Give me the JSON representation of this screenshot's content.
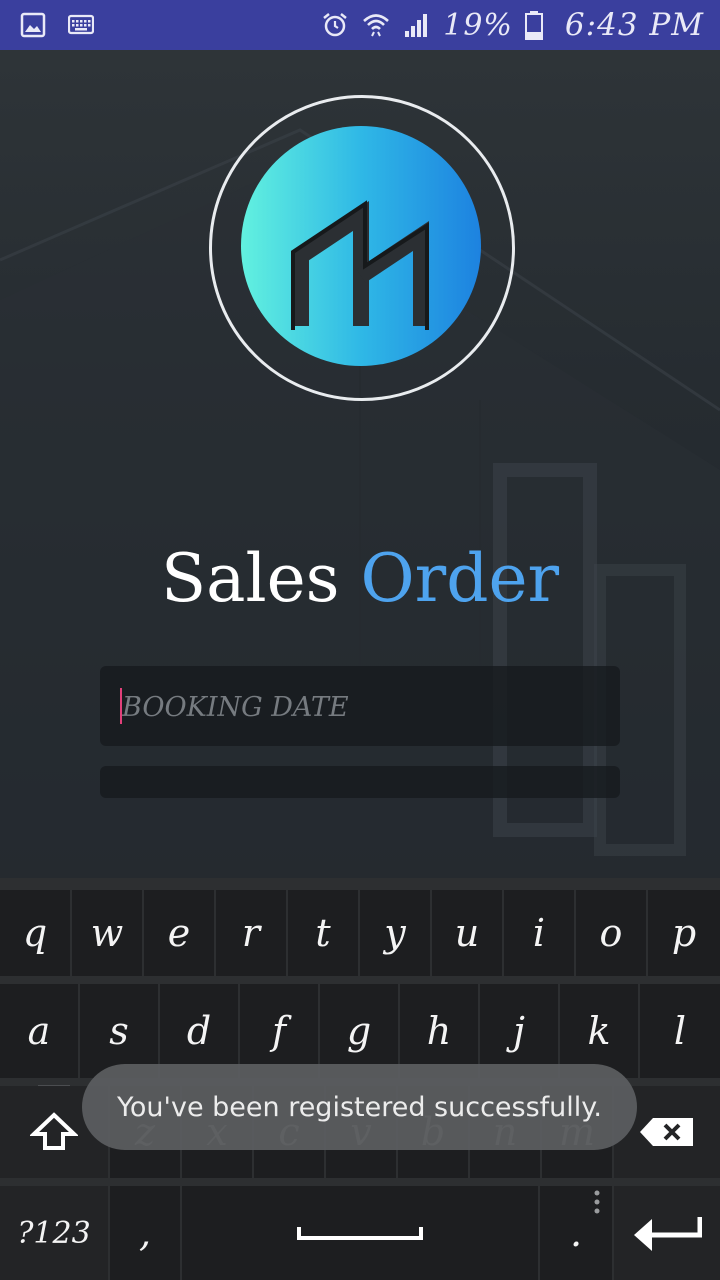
{
  "status_bar": {
    "icons_left": [
      "image-icon",
      "keyboard-icon"
    ],
    "icons_right": [
      "alarm-icon",
      "wifi-icon",
      "signal-icon",
      "battery-icon"
    ],
    "battery": "19%",
    "time": "6:43 PM"
  },
  "app": {
    "title_part1": "Sales",
    "title_part2": "Order",
    "accent_color": "#4ea3ee",
    "booking_date_placeholder": "BOOKING DATE"
  },
  "keyboard": {
    "row1": [
      "q",
      "w",
      "e",
      "r",
      "t",
      "y",
      "u",
      "i",
      "o",
      "p"
    ],
    "row2": [
      "a",
      "s",
      "d",
      "f",
      "g",
      "h",
      "j",
      "k",
      "l"
    ],
    "row3": [
      "z",
      "x",
      "c",
      "v",
      "b",
      "n",
      "m"
    ],
    "symbols_label": "?123",
    "comma": ",",
    "period": "."
  },
  "toast": {
    "message": "You've been registered successfully."
  }
}
